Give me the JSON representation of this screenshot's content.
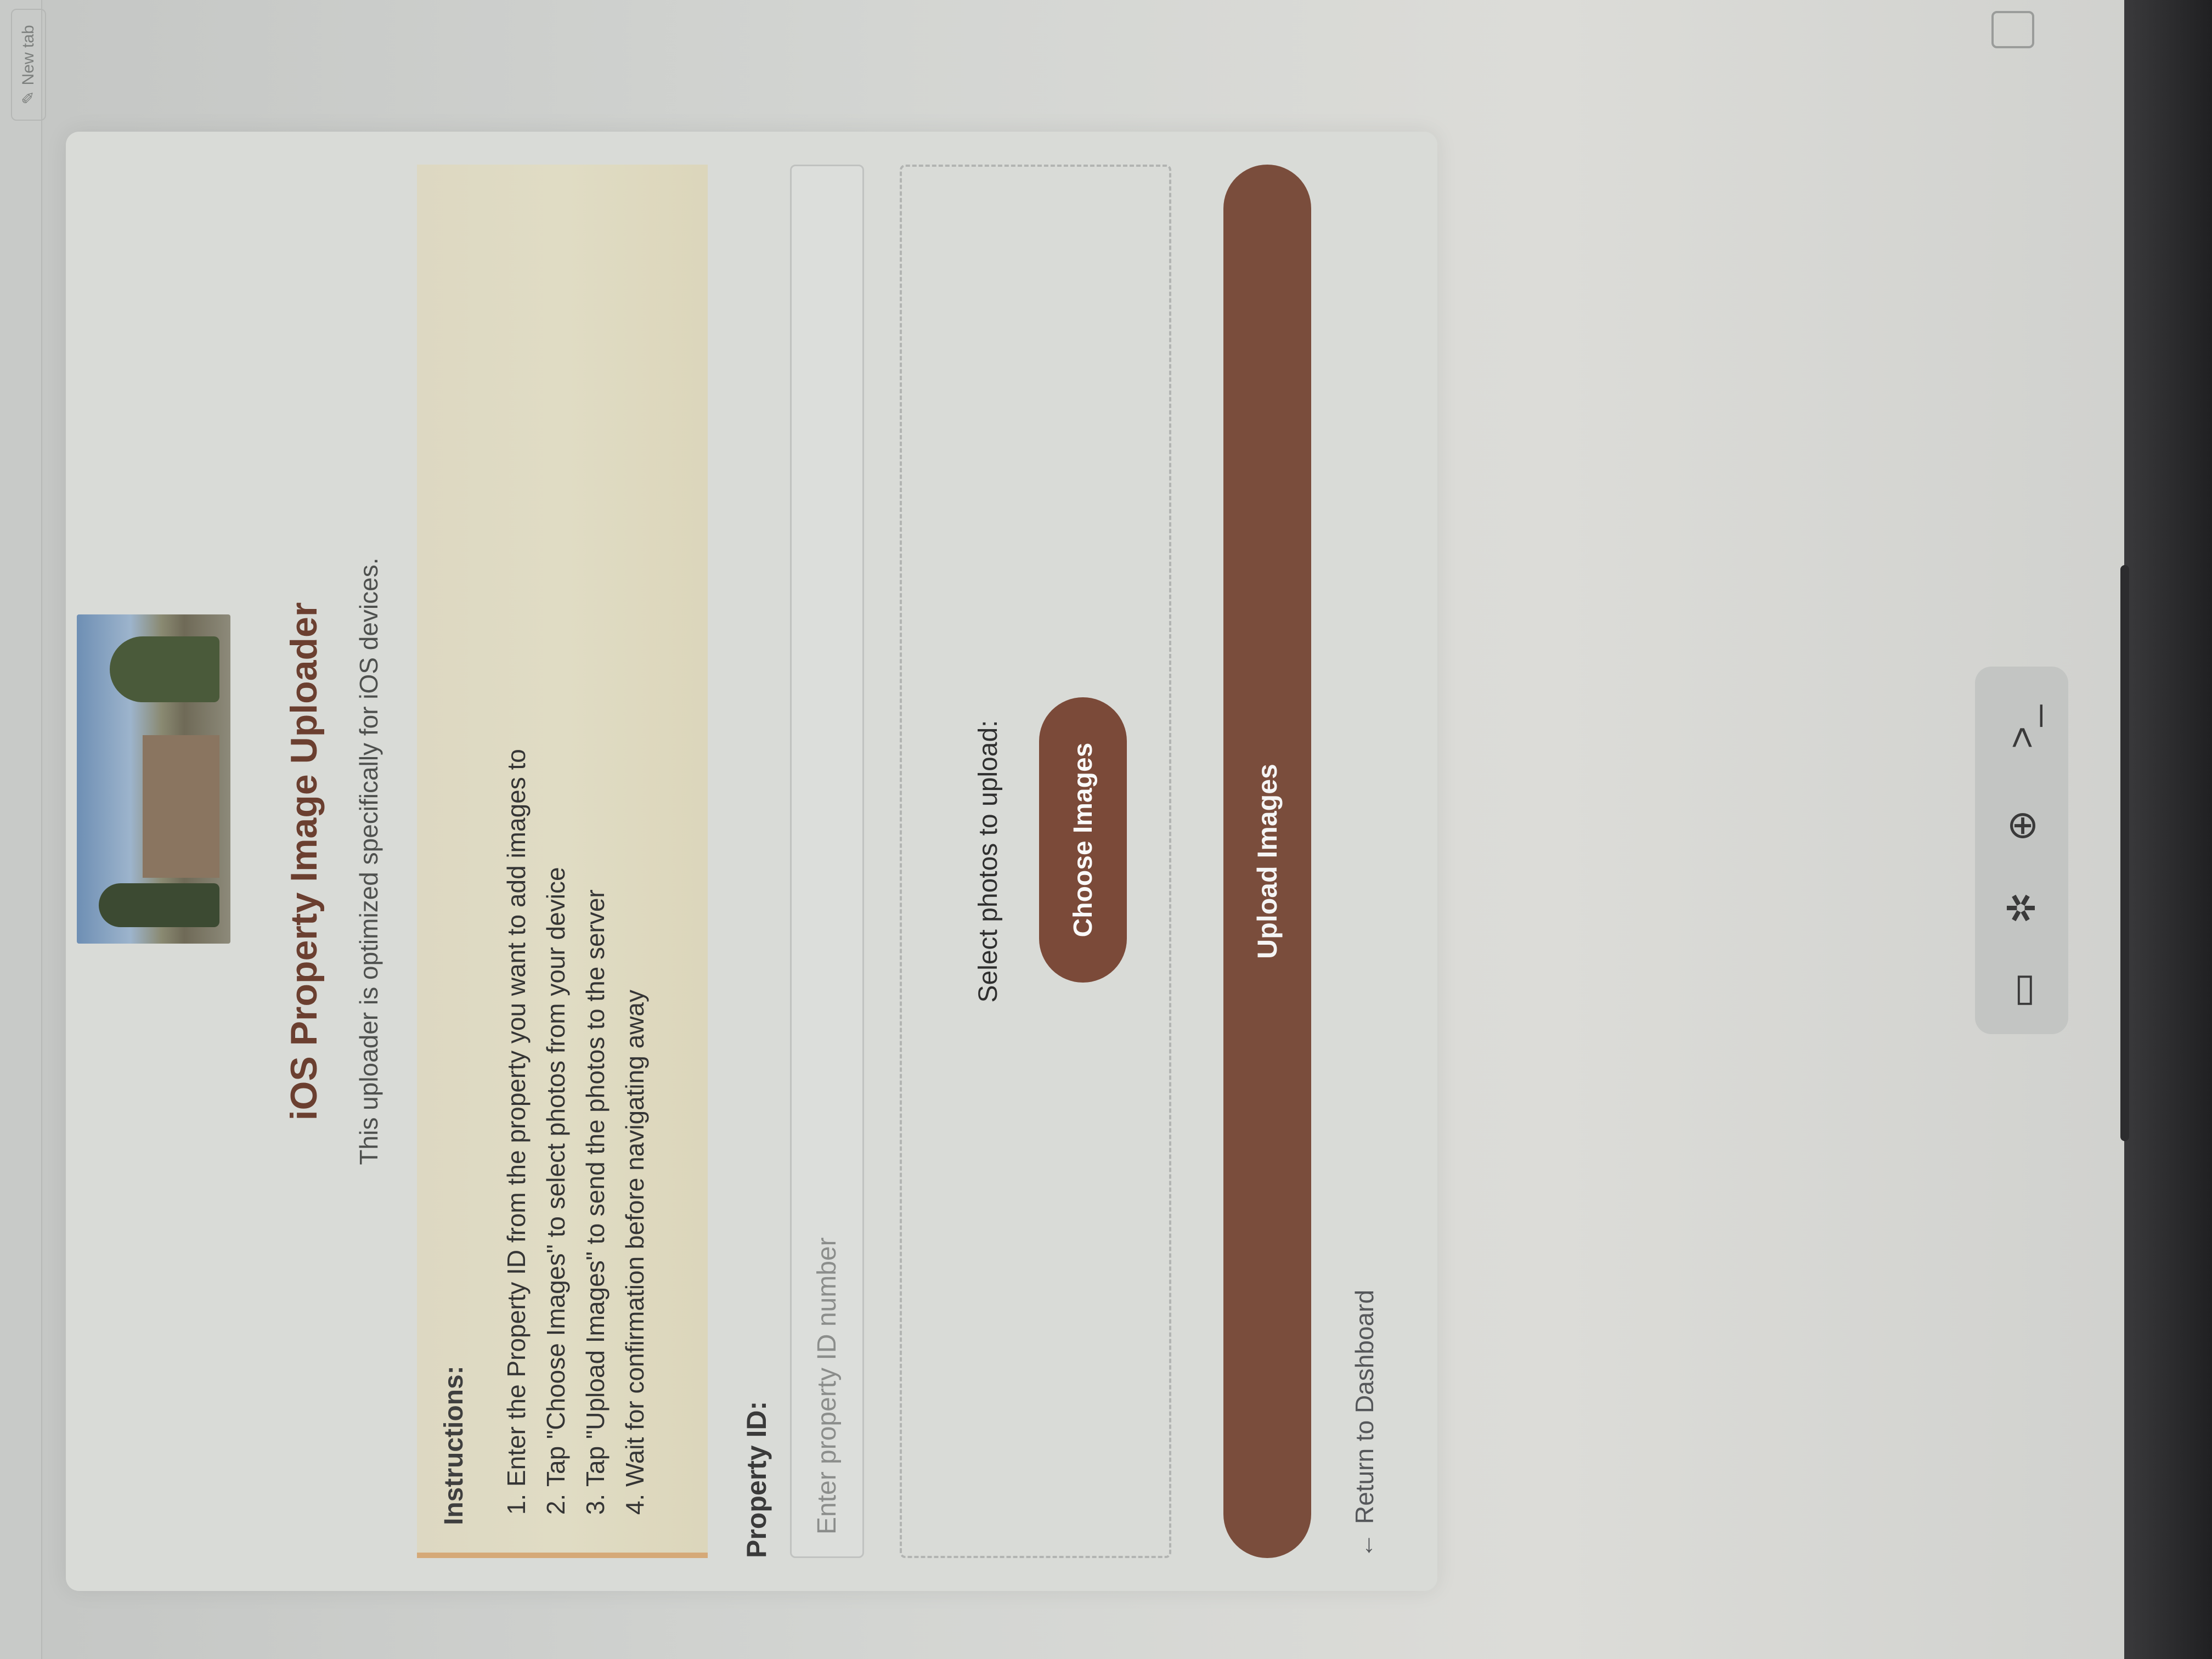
{
  "browser": {
    "new_tab_label": "New tab"
  },
  "page": {
    "title": "iOS Property Image Uploader",
    "subtitle": "This uploader is optimized specifically for iOS devices.",
    "instructions": {
      "heading": "Instructions:",
      "steps": [
        "Enter the Property ID from the property you want to add images to",
        "Tap \"Choose Images\" to select photos from your device",
        "Tap \"Upload Images\" to send the photos to the server",
        "Wait for confirmation before navigating away"
      ]
    },
    "property_id": {
      "label": "Property ID:",
      "placeholder": "Enter property ID number",
      "value": ""
    },
    "dropzone": {
      "label": "Select photos to upload:",
      "choose_button": "Choose Images"
    },
    "upload_button": "Upload Images",
    "back_link": "Return to Dashboard",
    "back_arrow": "←"
  },
  "dock": {
    "icons": [
      "tablet-icon",
      "grid-icon",
      "globe-icon",
      "terminal-icon"
    ],
    "glyphs": [
      "▭",
      "✲",
      "⊕",
      ">_"
    ]
  }
}
